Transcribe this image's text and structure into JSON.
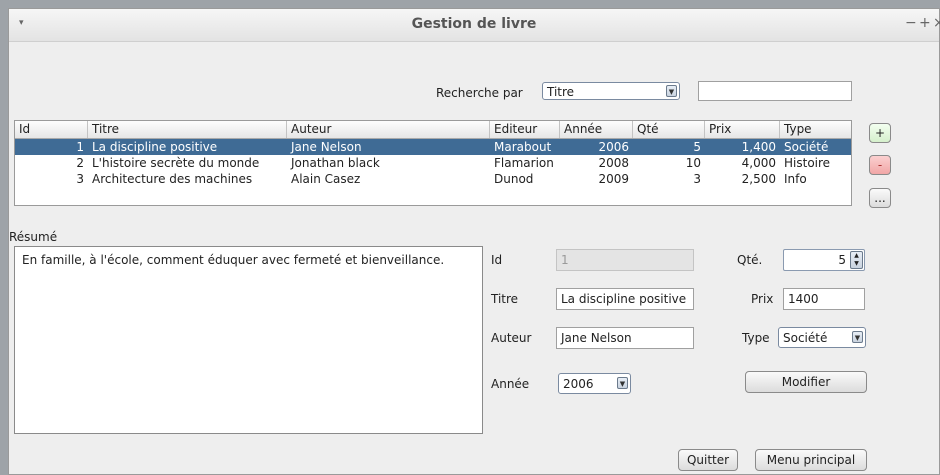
{
  "window": {
    "title": "Gestion de livre",
    "menu_icon": "▾",
    "controls": [
      "−",
      "+",
      "×"
    ]
  },
  "search": {
    "label": "Recherche par",
    "by": "Titre",
    "query": ""
  },
  "table": {
    "headers": [
      "Id",
      "Titre",
      "Auteur",
      "Editeur",
      "Année",
      "Qté",
      "Prix",
      "Type"
    ],
    "rows": [
      [
        "1",
        "La discipline positive",
        "Jane Nelson",
        "Marabout",
        "2006",
        "5",
        "1,400",
        "Société"
      ],
      [
        "2",
        "L'histoire secrète du monde",
        "Jonathan black",
        "Flamarion",
        "2008",
        "10",
        "4,000",
        "Histoire"
      ],
      [
        "3",
        "Architecture des machines",
        "Alain Casez",
        "Dunod",
        "2009",
        "3",
        "2,500",
        "Info"
      ]
    ],
    "selected_row": 0
  },
  "side_buttons": {
    "add": "+",
    "delete": "-",
    "more": "..."
  },
  "resume": {
    "label": "Résumé",
    "text": "En famille, à l'école, comment éduquer avec fermeté et bienveillance."
  },
  "form": {
    "id_label": "Id",
    "id_value": "1",
    "titre_label": "Titre",
    "titre_value": "La discipline positive",
    "auteur_label": "Auteur",
    "auteur_value": "Jane Nelson",
    "annee_label": "Année",
    "annee_value": "2006",
    "qte_label": "Qté.",
    "qte_value": "5",
    "prix_label": "Prix",
    "prix_value": "1400",
    "type_label": "Type",
    "type_value": "Société",
    "modifier_label": "Modifier"
  },
  "footer": {
    "quit_label": "Quitter",
    "menu_label": "Menu principal"
  },
  "colors": {
    "selection": "#3f6b95",
    "add_button": "#dff5d6",
    "delete_button": "#f6b3b3"
  }
}
